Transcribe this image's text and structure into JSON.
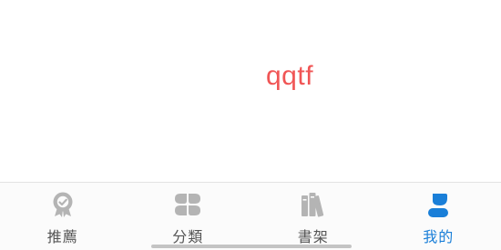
{
  "main": {
    "text": "qqtf"
  },
  "tabbar": {
    "items": [
      {
        "label": "推薦",
        "icon": "award-ribbon-icon",
        "active": false
      },
      {
        "label": "分類",
        "icon": "category-grid-icon",
        "active": false
      },
      {
        "label": "書架",
        "icon": "bookshelf-icon",
        "active": false
      },
      {
        "label": "我的",
        "icon": "user-profile-icon",
        "active": true
      }
    ]
  },
  "colors": {
    "text_accent": "#f05555",
    "tab_inactive": "#b8b8b8",
    "tab_active": "#1a7fd8"
  }
}
